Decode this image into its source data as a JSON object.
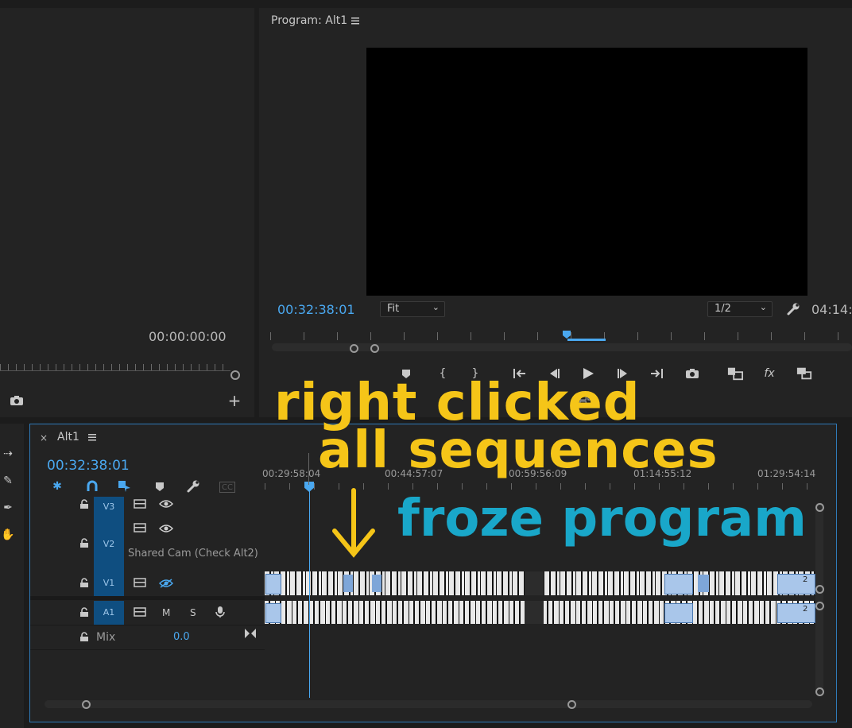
{
  "source_monitor": {
    "timecode": "00:00:00:00"
  },
  "program_monitor": {
    "title": "Program: Alt1",
    "timecode": "00:32:38:01",
    "fit_label": "Fit",
    "resolution_label": "1/2",
    "duration_partial": "04:14:"
  },
  "timeline": {
    "sequence_name": "Alt1",
    "timecode": "00:32:38:01",
    "ruler_labels": [
      "00:29:58:04",
      "00:44:57:07",
      "00:59:56:09",
      "01:14:55:12",
      "01:29:54:14"
    ],
    "tracks": {
      "v3": "V3",
      "v2": "V2",
      "v2_clip": "Shared Cam (Check Alt2)",
      "v1": "V1",
      "a1": "A1",
      "m_label": "M",
      "s_label": "S",
      "mix_label": "Mix",
      "mix_value": "0.0"
    },
    "clip_badge": "2",
    "accent_color": "#4aa8f0",
    "clip_color": "#a9c6ea"
  },
  "annotations": {
    "line1": "right clicked",
    "line2": "all sequences",
    "line3": "froze program",
    "yellow": "#f5c518",
    "cyan": "#19a7c9"
  }
}
